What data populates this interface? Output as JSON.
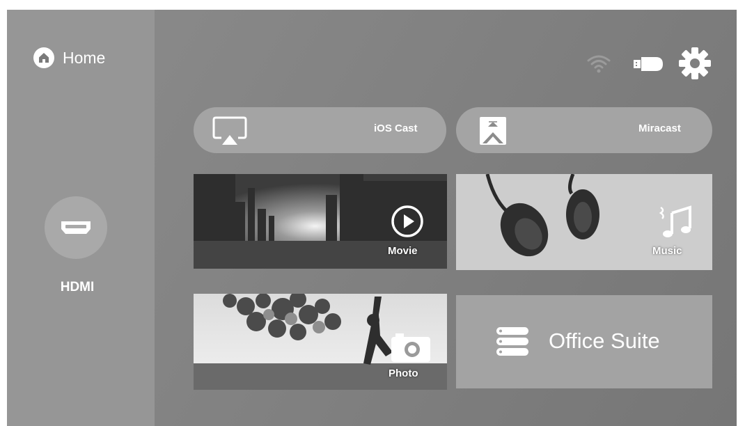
{
  "sidebar": {
    "home_label": "Home",
    "home_icon": "home-icon",
    "input_label": "HDMI",
    "input_icon": "hdmi-icon"
  },
  "status_bar": {
    "icons": [
      "wifi-icon",
      "usb-drive-icon",
      "settings-gear-icon"
    ]
  },
  "cast": {
    "ios_label": "iOS Cast",
    "ios_icon": "airplay-icon",
    "miracast_label": "Miracast",
    "miracast_icon": "miracast-icon"
  },
  "tiles": {
    "movie_label": "Movie",
    "music_label": "Music",
    "photo_label": "Photo",
    "office_label": "Office Suite"
  },
  "colors": {
    "background": "#828282",
    "sidebar": "#969696",
    "pill": "#a4a4a4",
    "text": "#ffffff"
  }
}
